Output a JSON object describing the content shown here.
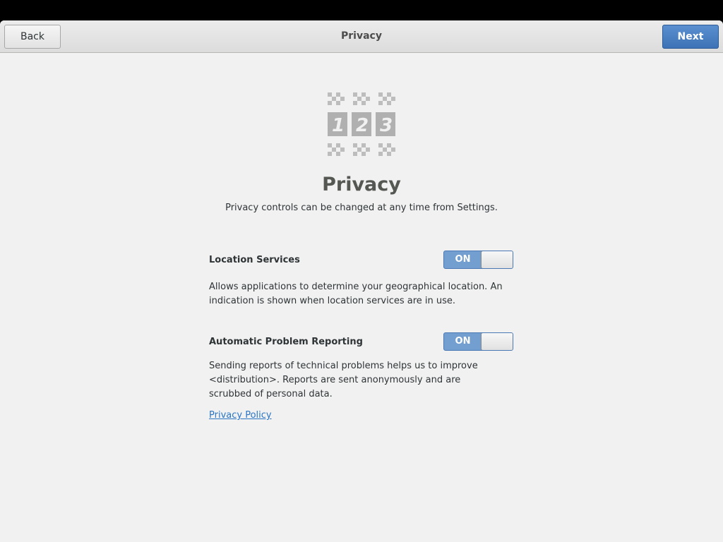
{
  "header": {
    "title": "Privacy",
    "back_label": "Back",
    "next_label": "Next"
  },
  "page": {
    "icon": "privacy-123-icon",
    "logo_digits": [
      "1",
      "2",
      "3"
    ],
    "heading": "Privacy",
    "subtitle": "Privacy controls can be changed at any time from Settings."
  },
  "location": {
    "label": "Location Services",
    "toggle": "ON",
    "description": "Allows applications to determine your geographical location. An indication is shown when location services are in use."
  },
  "reporting": {
    "label": "Automatic Problem Reporting",
    "toggle": "ON",
    "description": "Sending reports of technical problems helps us to improve <distribution>. Reports are sent anonymously and are scrubbed of personal data."
  },
  "policy_link": "Privacy Policy",
  "colors": {
    "accent": "#3d73b6",
    "switch_on": "#729fcf",
    "link": "#2a76c6",
    "background": "#f1f1f1",
    "icon_gray": "#b8b8b8"
  }
}
